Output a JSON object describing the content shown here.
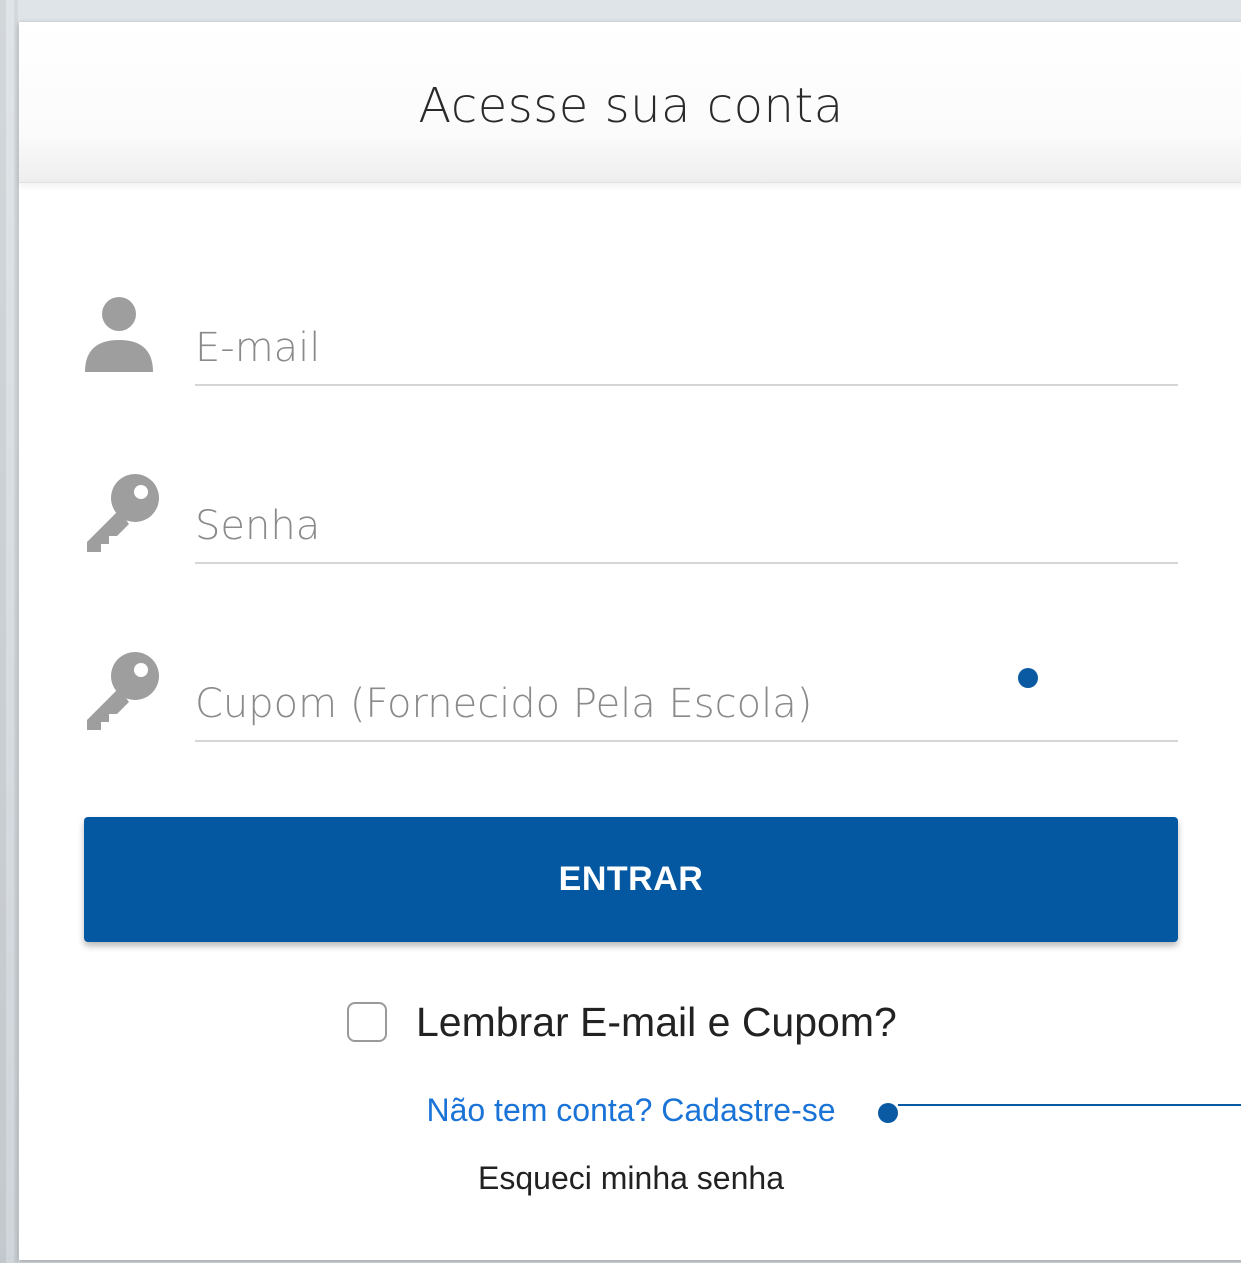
{
  "header": {
    "title": "Acesse sua conta"
  },
  "form": {
    "email": {
      "placeholder": "E-mail",
      "value": "",
      "icon": "user-icon"
    },
    "password": {
      "placeholder": "Senha",
      "value": "",
      "icon": "key-icon"
    },
    "coupon": {
      "placeholder": "Cupom (Fornecido Pela Escola)",
      "value": "",
      "icon": "key-icon"
    },
    "submit_label": "ENTRAR",
    "remember_label": "Lembrar E-mail e Cupom?",
    "remember_checked": false,
    "signup_link": "Não tem conta? Cadastre-se",
    "forgot_link": "Esqueci minha senha"
  },
  "colors": {
    "primary": "#0358a1",
    "link": "#1a73d6",
    "icon": "#9e9e9e",
    "annotation": "#0a5aa3"
  }
}
